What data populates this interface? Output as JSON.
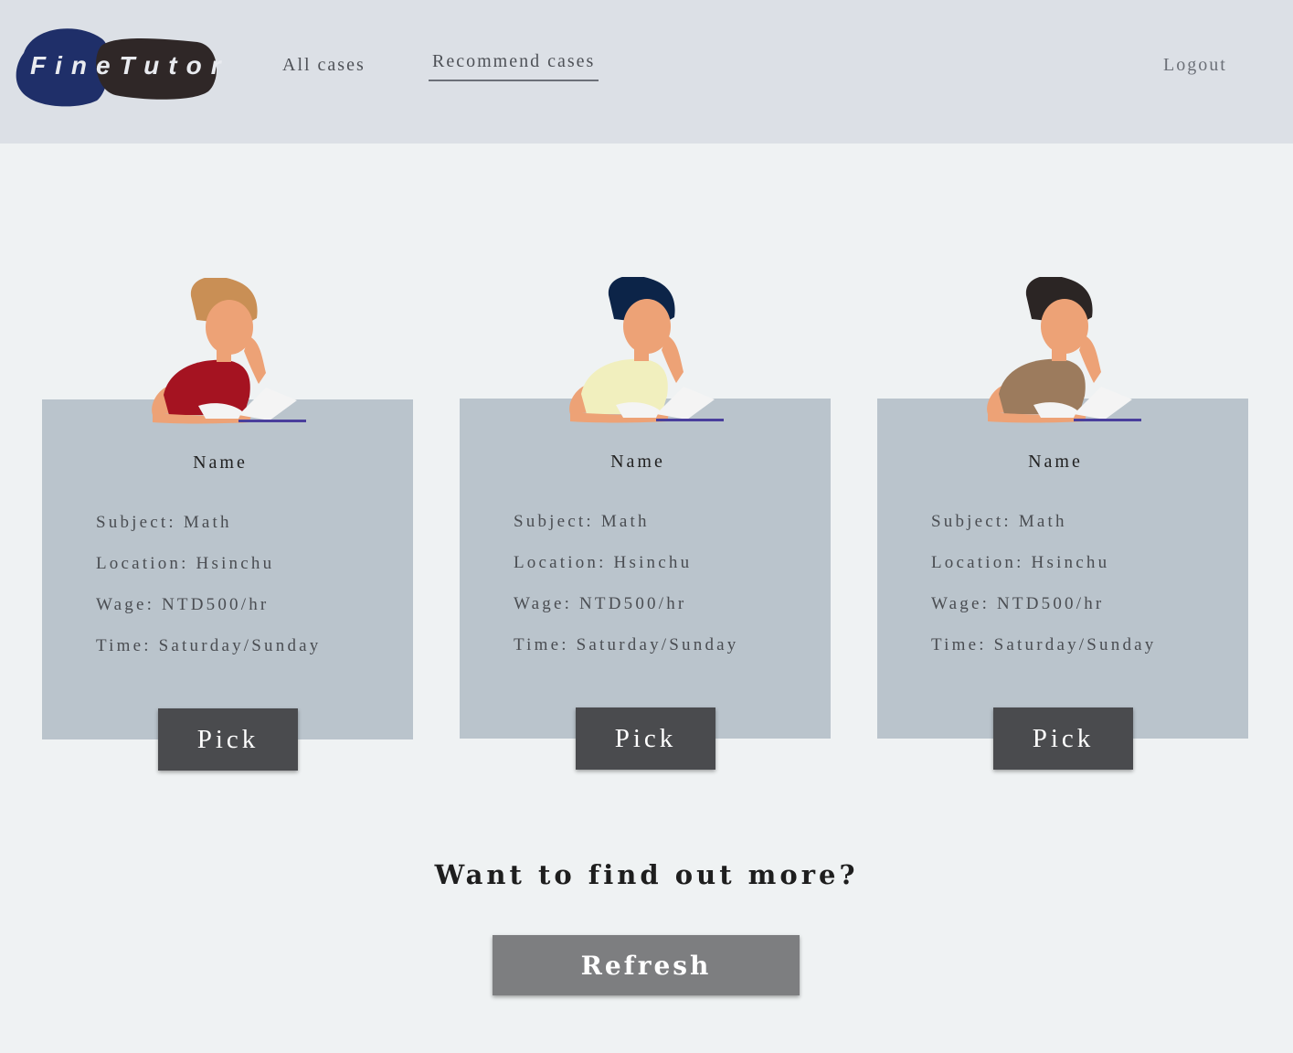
{
  "header": {
    "logo_text": "FineTutor",
    "nav": {
      "all_cases": "All cases",
      "recommend_cases": "Recommend cases",
      "logout": "Logout"
    }
  },
  "cards": [
    {
      "name": "Name",
      "subject": "Subject: Math",
      "location": "Location: Hsinchu",
      "wage": "Wage: NTD500/hr",
      "time": "Time: Saturday/Sunday",
      "pick_label": "Pick",
      "avatar": {
        "hair_color": "#c98f55",
        "shirt_color": "#a51321"
      }
    },
    {
      "name": "Name",
      "subject": "Subject: Math",
      "location": "Location: Hsinchu",
      "wage": "Wage: NTD500/hr",
      "time": "Time: Saturday/Sunday",
      "pick_label": "Pick",
      "avatar": {
        "hair_color": "#0c2448",
        "shirt_color": "#f1efbe"
      }
    },
    {
      "name": "Name",
      "subject": "Subject: Math",
      "location": "Location: Hsinchu",
      "wage": "Wage: NTD500/hr",
      "time": "Time: Saturday/Sunday",
      "pick_label": "Pick",
      "avatar": {
        "hair_color": "#2b2524",
        "shirt_color": "#9c7b5d"
      }
    }
  ],
  "footer": {
    "prompt": "Want to find out more?",
    "refresh_label": "Refresh"
  },
  "colors": {
    "header_bg": "#dce0e6",
    "page_bg": "#eff2f3",
    "card_bg": "#bac4cc",
    "pick_button": "#4a4b4e",
    "refresh_button": "#7d7e80",
    "logo_blue": "#1f2f69",
    "logo_dark": "#2f2727"
  }
}
